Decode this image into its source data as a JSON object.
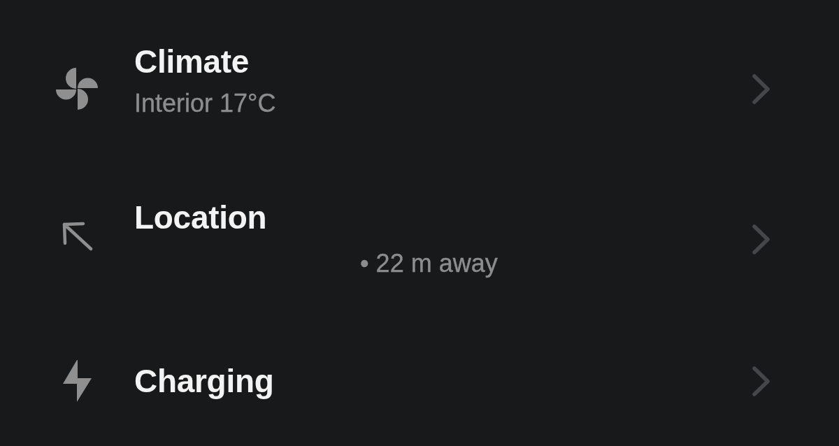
{
  "rows": [
    {
      "kind": "climate",
      "title": "Climate",
      "subtitle": "Interior 17°C"
    },
    {
      "kind": "location",
      "title": "Location",
      "subtitle": "• 22 m away"
    },
    {
      "kind": "charging",
      "title": "Charging"
    }
  ]
}
